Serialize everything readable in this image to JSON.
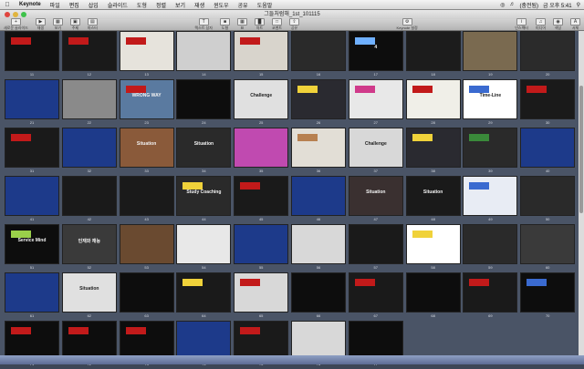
{
  "menubar": {
    "app_name": "Keynote",
    "items": [
      "파일",
      "편집",
      "삽입",
      "슬라이드",
      "도형",
      "정렬",
      "보기",
      "재생",
      "윈도우",
      "공유",
      "도움말"
    ],
    "clock": "금 오후 5:41",
    "battery": "(충전됨)"
  },
  "window": {
    "title": "그들처럼해_1st_101115"
  },
  "toolbar": {
    "items": [
      "새로운 슬라이드",
      "재생",
      "보기",
      "주제",
      "마스터",
      "텍스트 상자",
      "도형",
      "표",
      "차트",
      "코멘트",
      "공유",
      "Keynote 설정",
      "인스펙터",
      "미디어",
      "색상",
      "서체"
    ]
  },
  "slides": [
    {
      "n": "11",
      "bg": "#111",
      "text": "",
      "accent": "#c21a1a"
    },
    {
      "n": "12",
      "bg": "#1a1a1a",
      "text": "",
      "accent": "#c21a1a"
    },
    {
      "n": "13",
      "bg": "#e6e3dc",
      "text": "",
      "accent": "#c21a1a"
    },
    {
      "n": "14",
      "bg": "#cfcfcf",
      "text": "",
      "accent": ""
    },
    {
      "n": "15",
      "bg": "#d8d4cc",
      "text": "",
      "accent": "#c21a1a"
    },
    {
      "n": "16",
      "bg": "#2a2a2a",
      "text": "",
      "accent": ""
    },
    {
      "n": "17",
      "bg": "#0d0d0d",
      "text": "4",
      "accent": "#6fb0ff"
    },
    {
      "n": "18",
      "bg": "#1c1c1c",
      "text": "",
      "accent": ""
    },
    {
      "n": "19",
      "bg": "#7a6a50",
      "text": "",
      "accent": ""
    },
    {
      "n": "20",
      "bg": "#2b2b2b",
      "text": "",
      "accent": ""
    },
    {
      "n": "21",
      "bg": "#1d3a8a",
      "text": "",
      "accent": ""
    },
    {
      "n": "22",
      "bg": "#8a8a8a",
      "text": "",
      "accent": ""
    },
    {
      "n": "23",
      "bg": "#5a7aa0",
      "text": "WRONG WAY",
      "accent": "#c21a1a"
    },
    {
      "n": "24",
      "bg": "#0d0d0d",
      "text": "",
      "accent": ""
    },
    {
      "n": "25",
      "bg": "#e0e0e0",
      "text": "Challenge",
      "accent": ""
    },
    {
      "n": "26",
      "bg": "#2a2a30",
      "text": "",
      "accent": "#f0d23a"
    },
    {
      "n": "27",
      "bg": "#e8e8e8",
      "text": "",
      "accent": "#d03a8a"
    },
    {
      "n": "28",
      "bg": "#f0efe8",
      "text": "",
      "accent": "#c21a1a"
    },
    {
      "n": "29",
      "bg": "#ffffff",
      "text": "Time-Line",
      "accent": "#3a6ad0"
    },
    {
      "n": "30",
      "bg": "#1a1a1a",
      "text": "",
      "accent": "#c21a1a"
    },
    {
      "n": "31",
      "bg": "#1a1a1a",
      "text": "",
      "accent": "#c21a1a"
    },
    {
      "n": "32",
      "bg": "#1d3a8a",
      "text": "",
      "accent": ""
    },
    {
      "n": "33",
      "bg": "#8a5a3a",
      "text": "Situation",
      "accent": ""
    },
    {
      "n": "34",
      "bg": "#2a2a2a",
      "text": "Situation",
      "accent": ""
    },
    {
      "n": "35",
      "bg": "#c04ab0",
      "text": "",
      "accent": ""
    },
    {
      "n": "36",
      "bg": "#e2ded6",
      "text": "",
      "accent": "#b78050"
    },
    {
      "n": "37",
      "bg": "#d8d8d8",
      "text": "Challenge",
      "accent": ""
    },
    {
      "n": "38",
      "bg": "#2a2a30",
      "text": "",
      "accent": "#f0d23a"
    },
    {
      "n": "39",
      "bg": "#2a2a2a",
      "text": "",
      "accent": "#3a8a3a"
    },
    {
      "n": "40",
      "bg": "#1d3a8a",
      "text": "",
      "accent": ""
    },
    {
      "n": "41",
      "bg": "#1d3a8a",
      "text": "",
      "accent": ""
    },
    {
      "n": "42",
      "bg": "#1a1a1a",
      "text": "",
      "accent": ""
    },
    {
      "n": "43",
      "bg": "#1a1a1a",
      "text": "",
      "accent": ""
    },
    {
      "n": "44",
      "bg": "#2a2a2a",
      "text": "Study Coaching",
      "accent": "#f0d23a"
    },
    {
      "n": "45",
      "bg": "#1a1a1a",
      "text": "",
      "accent": "#c21a1a"
    },
    {
      "n": "46",
      "bg": "#1d3a8a",
      "text": "",
      "accent": ""
    },
    {
      "n": "47",
      "bg": "#3a3030",
      "text": "Situation",
      "accent": ""
    },
    {
      "n": "48",
      "bg": "#1a1a1a",
      "text": "Situation",
      "accent": ""
    },
    {
      "n": "49",
      "bg": "#e8ecf4",
      "text": "",
      "accent": "#3a6ad0"
    },
    {
      "n": "50",
      "bg": "#2a2a2a",
      "text": "",
      "accent": ""
    },
    {
      "n": "51",
      "bg": "#0d0d0d",
      "text": "Service Mind",
      "accent": "#9ad04a"
    },
    {
      "n": "52",
      "bg": "#3a3a3a",
      "text": "인재와 재능",
      "accent": ""
    },
    {
      "n": "53",
      "bg": "#6a4a30",
      "text": "",
      "accent": ""
    },
    {
      "n": "54",
      "bg": "#e8e8e8",
      "text": "",
      "accent": ""
    },
    {
      "n": "55",
      "bg": "#1d3a8a",
      "text": "",
      "accent": ""
    },
    {
      "n": "56",
      "bg": "#d8d8d8",
      "text": "",
      "accent": ""
    },
    {
      "n": "57",
      "bg": "#1a1a1a",
      "text": "",
      "accent": ""
    },
    {
      "n": "58",
      "bg": "#ffffff",
      "text": "",
      "accent": "#f0d23a"
    },
    {
      "n": "59",
      "bg": "#2a2a2a",
      "text": "",
      "accent": ""
    },
    {
      "n": "60",
      "bg": "#3a3a3a",
      "text": "",
      "accent": ""
    },
    {
      "n": "61",
      "bg": "#1d3a8a",
      "text": "",
      "accent": ""
    },
    {
      "n": "62",
      "bg": "#e0e0e0",
      "text": "Situation",
      "accent": ""
    },
    {
      "n": "63",
      "bg": "#0d0d0d",
      "text": "",
      "accent": ""
    },
    {
      "n": "64",
      "bg": "#1a1a1a",
      "text": "",
      "accent": "#f0d23a"
    },
    {
      "n": "65",
      "bg": "#d8d8d8",
      "text": "",
      "accent": "#c21a1a"
    },
    {
      "n": "66",
      "bg": "#0d0d0d",
      "text": "",
      "accent": ""
    },
    {
      "n": "67",
      "bg": "#1a1a1a",
      "text": "",
      "accent": "#c21a1a"
    },
    {
      "n": "68",
      "bg": "#0d0d0d",
      "text": "",
      "accent": ""
    },
    {
      "n": "69",
      "bg": "#1a1a1a",
      "text": "",
      "accent": "#c21a1a"
    },
    {
      "n": "70",
      "bg": "#0d0d0d",
      "text": "",
      "accent": "#3a6ad0"
    },
    {
      "n": "71",
      "bg": "#0d0d0d",
      "text": "",
      "accent": "#c21a1a"
    },
    {
      "n": "72",
      "bg": "#0d0d0d",
      "text": "",
      "accent": "#c21a1a"
    },
    {
      "n": "73",
      "bg": "#0d0d0d",
      "text": "",
      "accent": "#c21a1a"
    },
    {
      "n": "74",
      "bg": "#1d3a8a",
      "text": "",
      "accent": ""
    },
    {
      "n": "75",
      "bg": "#1a1a1a",
      "text": "",
      "accent": "#c21a1a"
    },
    {
      "n": "76",
      "bg": "#d8d8d8",
      "text": "",
      "accent": ""
    },
    {
      "n": "77",
      "bg": "#0d0d0d",
      "text": "",
      "accent": ""
    }
  ]
}
